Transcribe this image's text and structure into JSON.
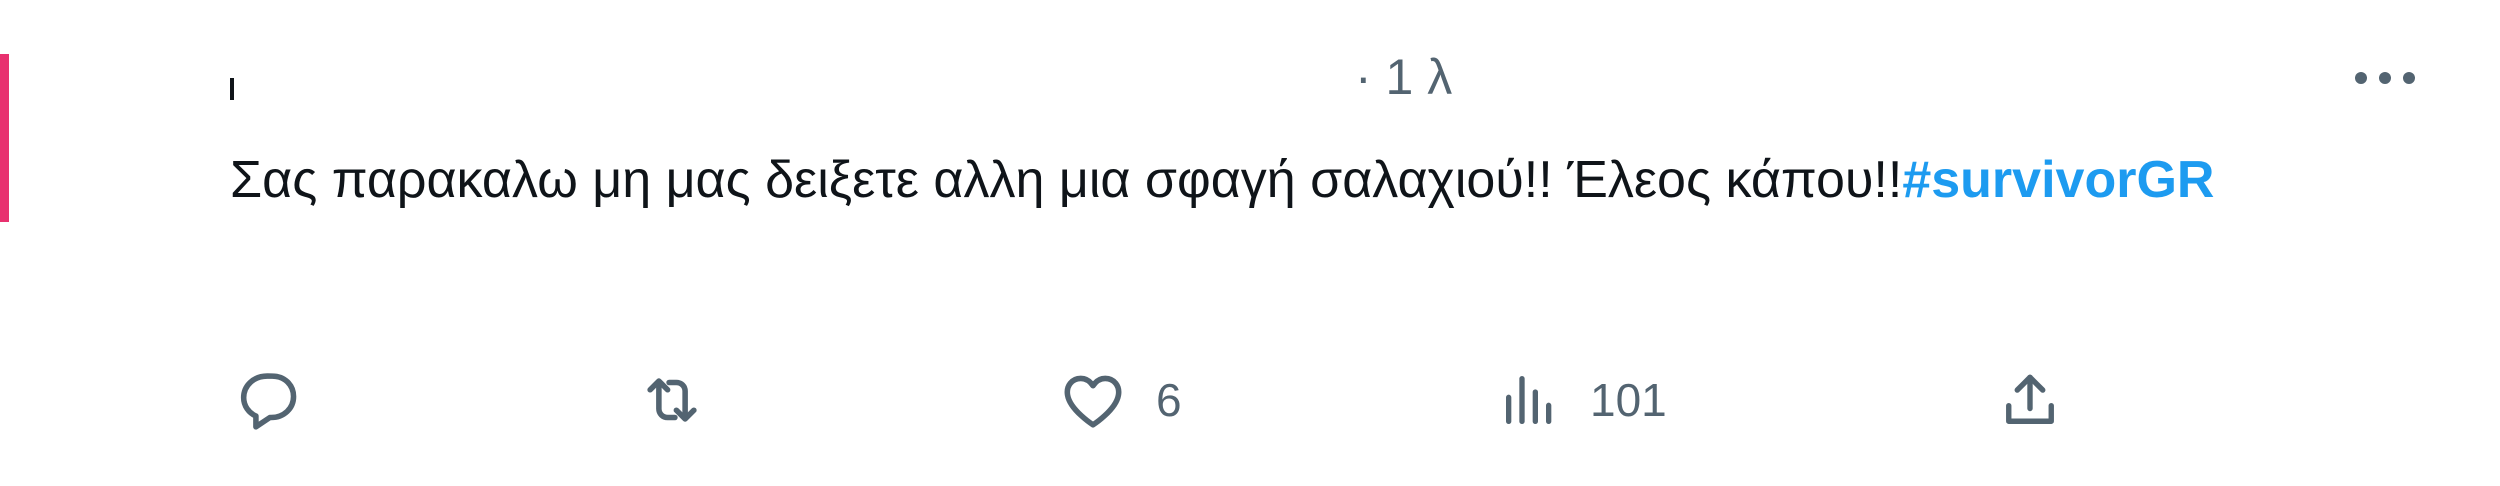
{
  "header": {
    "timestamp": "· 1 λ",
    "more_icon": "more-horizontal-icon"
  },
  "tweet": {
    "text": "Σας παρακαλω μη μας δειξετε αλλη μια σφαγή σαλαχιού!! Έλεος κάπου!!",
    "hashtag": "#survivorGR"
  },
  "actions": {
    "reply": {
      "icon": "reply-icon",
      "count": ""
    },
    "retweet": {
      "icon": "retweet-icon",
      "count": ""
    },
    "like": {
      "icon": "heart-icon",
      "count": "6"
    },
    "views": {
      "icon": "views-icon",
      "count": "101"
    },
    "share": {
      "icon": "share-icon"
    }
  },
  "colors": {
    "text": "#0f1419",
    "secondary": "#536471",
    "hashtag": "#1d9bf0",
    "avatar_accent": "#e8316f"
  }
}
